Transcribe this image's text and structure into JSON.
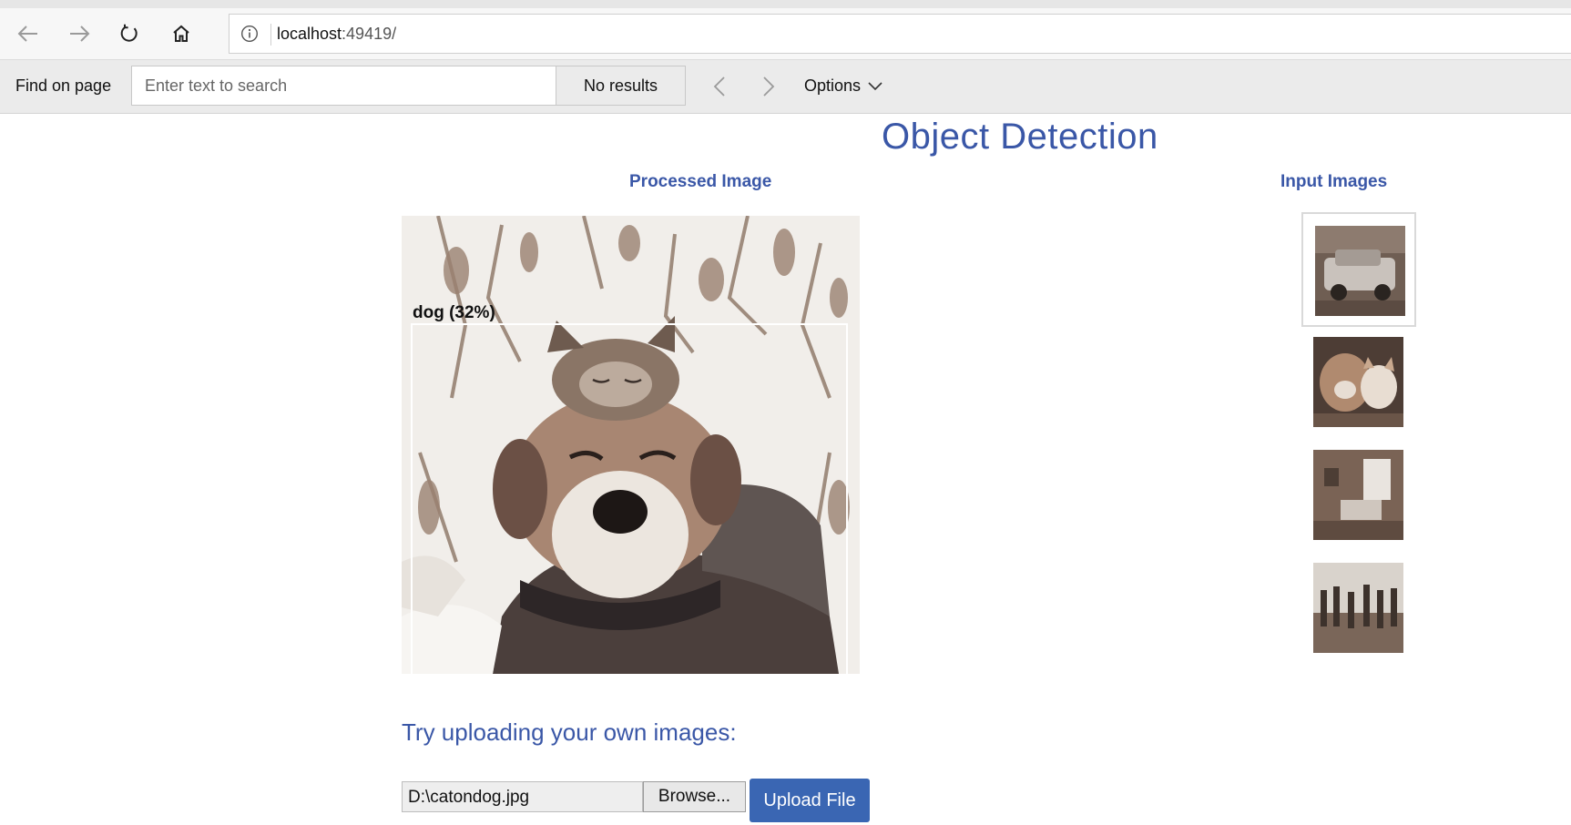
{
  "browser": {
    "url_host": "localhost",
    "url_rest": ":49419/",
    "find_bar": {
      "label": "Find on page",
      "placeholder": "Enter text to search",
      "results": "No results",
      "options_label": "Options"
    }
  },
  "page": {
    "title": "Object Detection",
    "processed_heading": "Processed Image",
    "input_heading": "Input Images",
    "detection_label": "dog (32%)",
    "upload_heading": "Try uploading your own images:",
    "file_path": "D:\\catondog.jpg",
    "browse_label": "Browse...",
    "upload_label": "Upload File"
  },
  "colors": {
    "accent": "#3a57a7",
    "upload_button": "#3a66b3"
  },
  "icons": [
    "back-arrow-icon",
    "forward-arrow-icon",
    "refresh-icon",
    "home-icon",
    "info-icon",
    "chevron-left-icon",
    "chevron-right-icon",
    "chevron-down-icon"
  ]
}
